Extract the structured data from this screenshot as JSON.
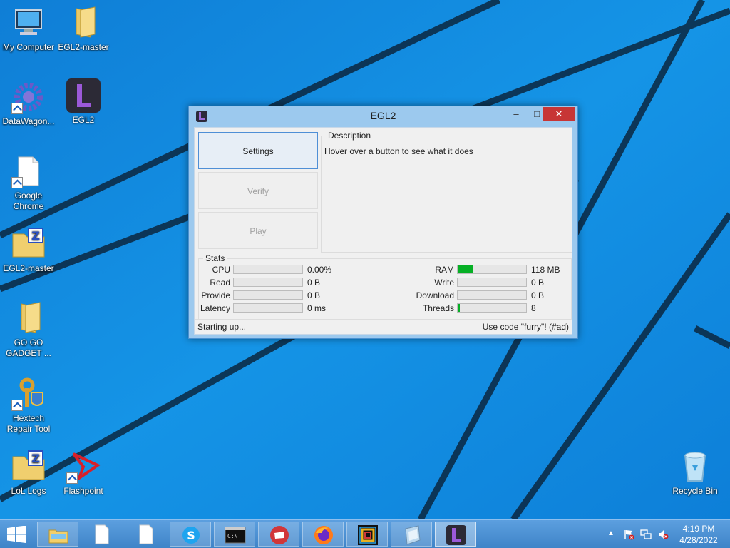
{
  "desktop": {
    "icons": [
      {
        "label": "My Computer"
      },
      {
        "label": "EGL2-master"
      },
      {
        "label": "DataWagon..."
      },
      {
        "label": "EGL2"
      },
      {
        "label": "Google Chrome"
      },
      {
        "label": "EGL2-master"
      },
      {
        "label": "GO GO GADGET ..."
      },
      {
        "label": "Hextech Repair Tool"
      },
      {
        "label": "LoL Logs"
      },
      {
        "label": "Flashpoint"
      },
      {
        "label": "Recycle Bin"
      }
    ]
  },
  "window": {
    "title": "EGL2",
    "min_glyph": "–",
    "max_glyph": "□",
    "close_glyph": "✕",
    "buttons": {
      "settings": "Settings",
      "verify": "Verify",
      "play": "Play"
    },
    "description": {
      "label": "Description",
      "text": "Hover over a button to see what it does"
    },
    "stats": {
      "label": "Stats",
      "left": [
        {
          "label": "CPU",
          "value": "0.00%",
          "fill": 0
        },
        {
          "label": "Read",
          "value": "0 B",
          "fill": 0
        },
        {
          "label": "Provide",
          "value": "0 B",
          "fill": 0
        },
        {
          "label": "Latency",
          "value": "0 ms",
          "fill": 0
        }
      ],
      "right": [
        {
          "label": "RAM",
          "value": "118 MB",
          "fill": 0.23
        },
        {
          "label": "Write",
          "value": "0 B",
          "fill": 0
        },
        {
          "label": "Download",
          "value": "0 B",
          "fill": 0
        },
        {
          "label": "Threads",
          "value": "8",
          "fill": 0.03
        }
      ]
    },
    "status": {
      "left": "Starting up...",
      "right": "Use code \"furry\"! (#ad)"
    }
  },
  "taskbar": {
    "clock_time": "4:19 PM",
    "clock_date": "4/28/2022",
    "items": [
      "file-explorer",
      "document",
      "document",
      "skype",
      "command-prompt",
      "riot-client",
      "firefox",
      "flashpoint-launcher",
      "unknown-app",
      "egl2"
    ]
  },
  "colors": {
    "desktop_bg": "#0a86dc",
    "progress_green": "#06b025",
    "close_red": "#c73535",
    "window_frame": "#9cc9ee"
  }
}
